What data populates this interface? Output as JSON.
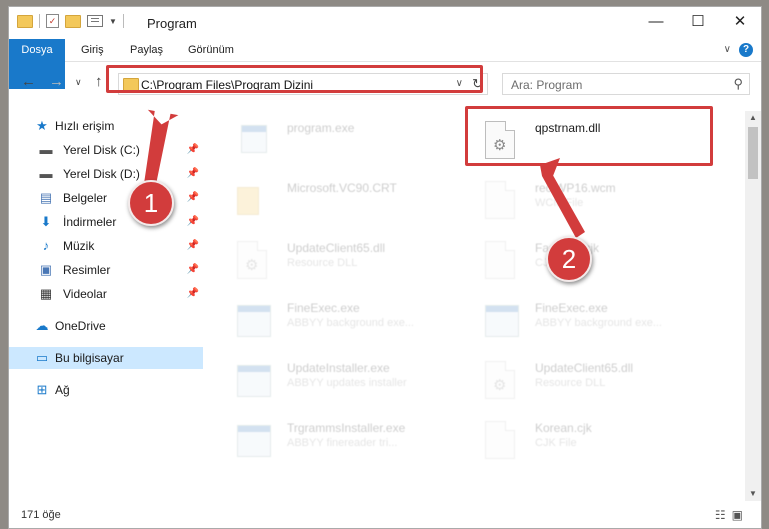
{
  "window": {
    "title": "Program",
    "controls": {
      "minimize": "—",
      "maximize": "☐",
      "close": "✕"
    }
  },
  "ribbon": {
    "tabs": [
      "Dosya",
      "Giriş",
      "Paylaş",
      "Görünüm"
    ],
    "expand": "∨",
    "help": "?"
  },
  "address": {
    "path": "C:\\Program Files\\Program Dizini"
  },
  "search": {
    "placeholder": "Ara: Program"
  },
  "sidebar": {
    "quick_access": "Hızlı erişim",
    "items": [
      {
        "label": "Yerel Disk (C:)",
        "icon": "drive-icon"
      },
      {
        "label": "Yerel Disk (D:)",
        "icon": "drive-icon"
      },
      {
        "label": "Belgeler",
        "icon": "documents-icon"
      },
      {
        "label": "İndirmeler",
        "icon": "downloads-icon"
      },
      {
        "label": "Müzik",
        "icon": "music-icon"
      },
      {
        "label": "Resimler",
        "icon": "pictures-icon"
      },
      {
        "label": "Videolar",
        "icon": "videos-icon"
      }
    ],
    "onedrive": "OneDrive",
    "this_pc": "Bu bilgisayar",
    "network": "Ağ"
  },
  "files": [
    {
      "name": "program.exe",
      "type": "",
      "icon": "installer-icon"
    },
    {
      "name": "qpstrnam.dll",
      "type": "",
      "icon": "dll-icon"
    },
    {
      "name": "Microsoft.VC90.CRT",
      "type": "",
      "icon": "folder-icon"
    },
    {
      "name": "rectWP16.wcm",
      "type": "WCM File",
      "icon": "file-icon"
    },
    {
      "name": "UpdateClient65.dll",
      "type": "Resource DLL",
      "icon": "dll-icon"
    },
    {
      "name": "FastPDF.cjk",
      "type": "CJK File",
      "icon": "file-icon"
    },
    {
      "name": "FineExec.exe",
      "type": "ABBYY background exe...",
      "icon": "exe-icon"
    },
    {
      "name": "FineExec.exe",
      "type": "ABBYY background exe...",
      "icon": "exe-icon"
    },
    {
      "name": "UpdateInstaller.exe",
      "type": "ABBYY updates installer",
      "icon": "exe-icon"
    },
    {
      "name": "UpdateClient65.dll",
      "type": "Resource DLL",
      "icon": "dll-icon"
    },
    {
      "name": "TrgrammsInstaller.exe",
      "type": "ABBYY finereader tri...",
      "icon": "exe-icon"
    },
    {
      "name": "Korean.cjk",
      "type": "CJK File",
      "icon": "file-icon"
    }
  ],
  "status": {
    "count": "171 öğe"
  },
  "annotations": {
    "badge1": "1",
    "badge2": "2",
    "color": "#d23c3c"
  }
}
